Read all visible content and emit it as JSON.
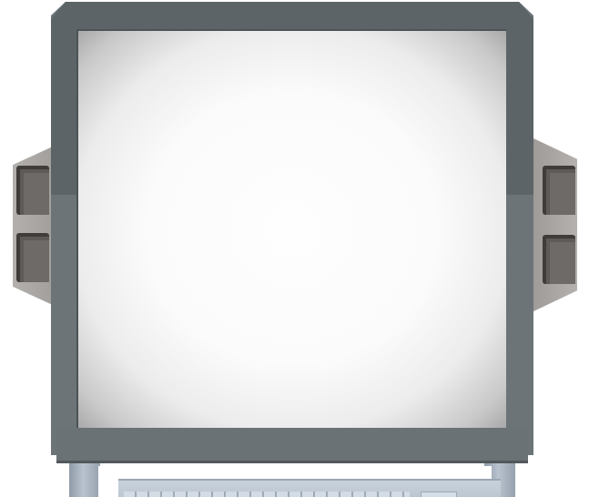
{
  "scene": {
    "description_type": "game-sprite",
    "object": "crt-computer-monitor"
  },
  "monitor": {
    "screen_state": "blank-glowing"
  },
  "controls": {
    "left_buttons": [
      "left-top-button",
      "left-bottom-button"
    ],
    "right_buttons": [
      "right-top-button",
      "right-bottom-button"
    ]
  },
  "colors": {
    "bezel": "#6c7478",
    "bezel_top": "#5d6468",
    "screen_glow": "#fefefe",
    "screen_edge": "#a9a9a9",
    "side_housing": "#a8a6a3",
    "button": "#5e5a58",
    "keyboard": "#c9d2dc"
  }
}
